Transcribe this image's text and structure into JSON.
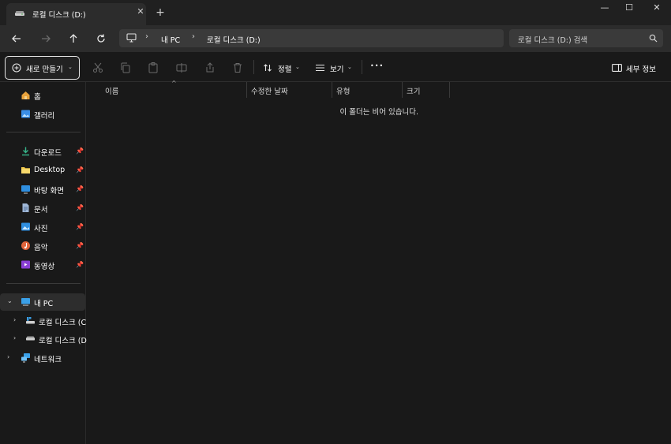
{
  "tab": {
    "title": "로컬 디스크 (D:)",
    "icon": "drive-icon",
    "close_icon": "close-icon"
  },
  "new_tab_glyph": "+",
  "window_controls": {
    "minimize": "—",
    "maximize": "☐",
    "close": "✕"
  },
  "nav": {
    "breadcrumb": [
      "내 PC",
      "로컬 디스크 (D:)"
    ],
    "search_placeholder": "로컬 디스크 (D:) 검색"
  },
  "command_bar": {
    "new_label": "새로 만들기",
    "sort_label": "정렬",
    "view_label": "보기",
    "more_glyph": "•••",
    "details_label": "세부 정보"
  },
  "sidebar": {
    "home": "홈",
    "gallery": "갤러리",
    "quick_access": [
      {
        "label": "다운로드",
        "icon": "download-icon"
      },
      {
        "label": "Desktop",
        "icon": "folder-icon"
      },
      {
        "label": "바탕 화면",
        "icon": "desktop-icon"
      },
      {
        "label": "문서",
        "icon": "document-icon"
      },
      {
        "label": "사진",
        "icon": "pictures-icon"
      },
      {
        "label": "음악",
        "icon": "music-icon"
      },
      {
        "label": "동영상",
        "icon": "video-icon"
      }
    ],
    "this_pc": "내 PC",
    "drives": [
      "로컬 디스크 (C",
      "로컬 디스크 (D"
    ],
    "network": "네트워크"
  },
  "columns": [
    "이름",
    "수정한 날짜",
    "유형",
    "크기"
  ],
  "empty_message": "이 폴더는 비어 있습니다.",
  "colors": {
    "background": "#191919",
    "bar": "#2c2c2c",
    "text": "#ffffff"
  }
}
